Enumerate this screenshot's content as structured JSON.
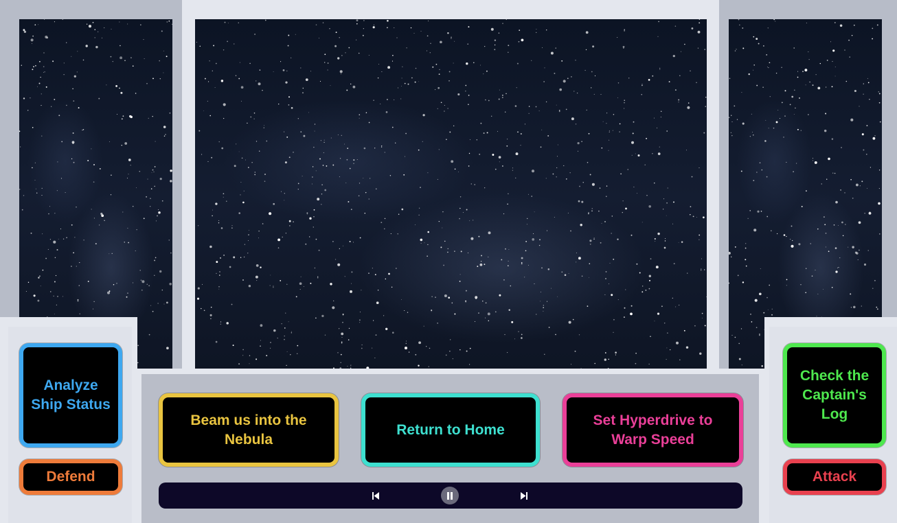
{
  "buttons": {
    "analyze": "Analyze Ship Status",
    "defend": "Defend",
    "captain": "Check the Captain's Log",
    "attack": "Attack",
    "beam": "Beam us into the Nebula",
    "home": "Return to Home",
    "hyper": "Set Hyperdrive to Warp Speed"
  },
  "player": {
    "prev_icon": "skip-previous-icon",
    "pause_icon": "pause-icon",
    "next_icon": "skip-next-icon"
  },
  "colors": {
    "analyze": "#3ea8f0",
    "defend": "#ee7b3a",
    "captain": "#4ee84e",
    "attack": "#e9414f",
    "beam": "#e9c440",
    "home": "#3ee0d0",
    "hyper": "#ea3f98"
  }
}
